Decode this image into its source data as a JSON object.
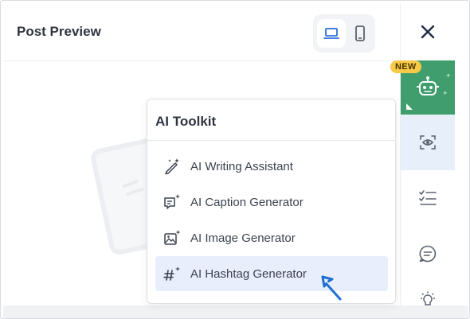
{
  "header": {
    "title": "Post Preview"
  },
  "device_toggle": {
    "selected": "desktop",
    "options": [
      "desktop-icon",
      "mobile-icon"
    ]
  },
  "sidebar": {
    "items": [
      {
        "icon": "close-icon"
      },
      {
        "icon": "ai-robot-icon",
        "badge": "NEW"
      },
      {
        "icon": "preview-eye-icon",
        "active": true
      },
      {
        "icon": "checklist-icon"
      },
      {
        "icon": "comment-icon"
      },
      {
        "icon": "lightbulb-icon"
      }
    ]
  },
  "popup": {
    "title": "AI Toolkit",
    "items": [
      {
        "label": "AI Writing Assistant",
        "icon": "magic-pen-icon"
      },
      {
        "label": "AI Caption Generator",
        "icon": "caption-icon"
      },
      {
        "label": "AI Image Generator",
        "icon": "image-sparkle-icon"
      },
      {
        "label": "AI Hashtag Generator",
        "icon": "hashtag-sparkle-icon",
        "highlighted": true
      }
    ]
  },
  "colors": {
    "accent": "#2f6fdd",
    "ai_green": "#3f9d6e",
    "highlight": "#e8eefb",
    "badge": "#f7c948"
  }
}
